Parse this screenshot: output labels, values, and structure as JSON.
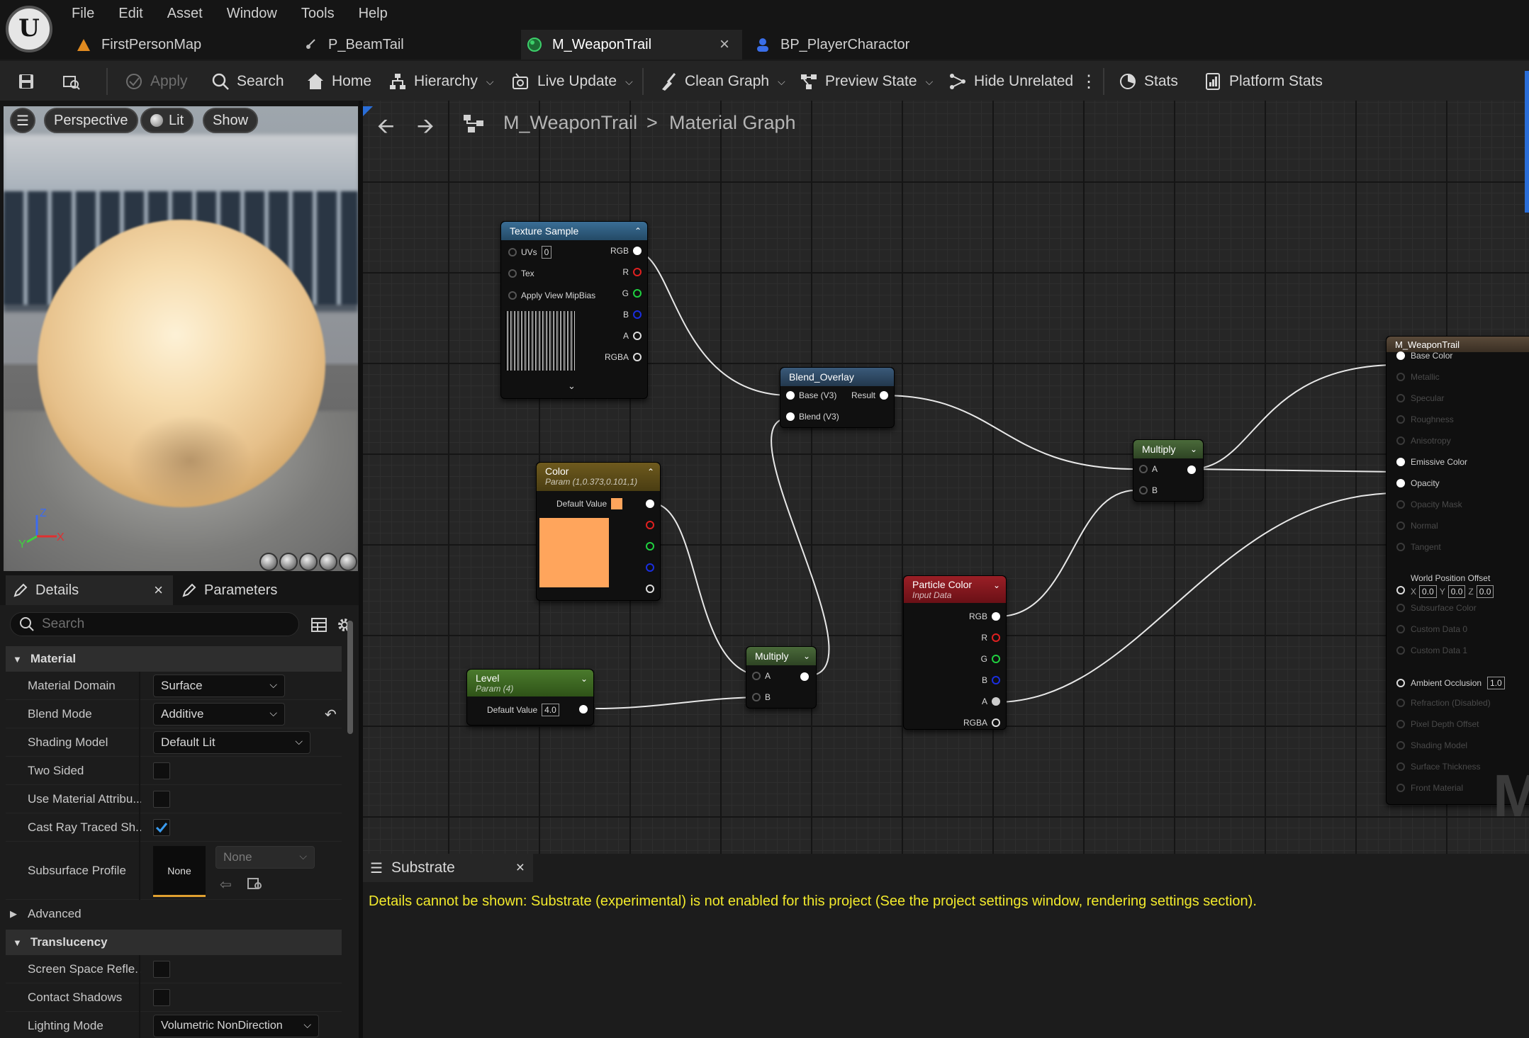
{
  "app": {
    "logo": "unreal-engine-logo"
  },
  "menu": [
    "File",
    "Edit",
    "Asset",
    "Window",
    "Tools",
    "Help"
  ],
  "tabs": [
    {
      "label": "FirstPersonMap",
      "icon": "level-icon"
    },
    {
      "label": "P_BeamTail",
      "icon": "particle-icon"
    },
    {
      "label": "M_WeaponTrail",
      "icon": "material-icon",
      "close": "×",
      "active": true
    },
    {
      "label": "BP_PlayerCharactor",
      "icon": "blueprint-icon"
    }
  ],
  "toolbar": {
    "apply": "Apply",
    "search": "Search",
    "home": "Home",
    "hierarchy": "Hierarchy",
    "live_update": "Live Update",
    "clean_graph": "Clean Graph",
    "preview_state": "Preview State",
    "hide_unrelated": "Hide Unrelated",
    "stats": "Stats",
    "platform_stats": "Platform Stats"
  },
  "viewport": {
    "perspective": "Perspective",
    "lit": "Lit",
    "show": "Show",
    "axis_z": "Z",
    "axis_y": "Y",
    "axis_x": "X"
  },
  "details": {
    "tab_details": "Details",
    "tab_parameters": "Parameters",
    "close": "×",
    "search_placeholder": "Search",
    "material_category": "Material",
    "rows": {
      "material_domain": {
        "label": "Material Domain",
        "value": "Surface"
      },
      "blend_mode": {
        "label": "Blend Mode",
        "value": "Additive"
      },
      "shading_model": {
        "label": "Shading Model",
        "value": "Default Lit"
      },
      "two_sided": {
        "label": "Two Sided",
        "checked": false
      },
      "use_material_attributes": {
        "label": "Use Material Attribu...",
        "checked": false
      },
      "cast_ray_traced": {
        "label": "Cast Ray Traced Sh...",
        "checked": true
      },
      "subsurface_profile": {
        "label": "Subsurface Profile",
        "thumb": "None",
        "value": "None"
      }
    },
    "advanced": "Advanced",
    "translucency_category": "Translucency",
    "t_rows": {
      "screen_space": {
        "label": "Screen Space Refle...",
        "checked": false
      },
      "contact_shadows": {
        "label": "Contact Shadows",
        "checked": false
      },
      "lighting_mode": {
        "label": "Lighting Mode",
        "value": "Volumetric NonDirection"
      }
    }
  },
  "graph": {
    "breadcrumb_asset": "M_WeaponTrail",
    "breadcrumb_sep": ">",
    "breadcrumb_graph": "Material Graph",
    "texture_sample": {
      "title": "Texture Sample",
      "uvs": "UVs",
      "uvs_val": "0",
      "tex": "Tex",
      "mip": "Apply View MipBias",
      "out": [
        "RGB",
        "R",
        "G",
        "B",
        "A",
        "RGBA"
      ]
    },
    "blend_overlay": {
      "title": "Blend_Overlay",
      "base": "Base (V3)",
      "blend": "Blend (V3)",
      "result": "Result"
    },
    "color": {
      "title": "Color",
      "subtitle": "Param (1,0.373,0.101,1)",
      "default_label": "Default Value",
      "swatch": "#ffa55c"
    },
    "level": {
      "title": "Level",
      "subtitle": "Param (4)",
      "default_label": "Default Value",
      "default_val": "4.0"
    },
    "multiply1": {
      "title": "Multiply",
      "a": "A",
      "b": "B"
    },
    "multiply2": {
      "title": "Multiply",
      "a": "A",
      "b": "B"
    },
    "particle_color": {
      "title": "Particle Color",
      "subtitle": "Input Data",
      "out": [
        "RGB",
        "R",
        "G",
        "B",
        "A",
        "RGBA"
      ]
    },
    "material_output": {
      "title": "M_WeaponTrail",
      "pins": [
        {
          "label": "Base Color",
          "active": true
        },
        {
          "label": "Metallic",
          "active": false
        },
        {
          "label": "Specular",
          "active": false
        },
        {
          "label": "Roughness",
          "active": false
        },
        {
          "label": "Anisotropy",
          "active": false
        },
        {
          "label": "Emissive Color",
          "active": true
        },
        {
          "label": "Opacity",
          "active": true
        },
        {
          "label": "Opacity Mask",
          "active": false
        },
        {
          "label": "Normal",
          "active": false
        },
        {
          "label": "Tangent",
          "active": false
        }
      ],
      "wpo": {
        "label": "World Position Offset",
        "x": "X",
        "xv": "0.0",
        "y": "Y",
        "yv": "0.0",
        "z": "Z",
        "zv": "0.0"
      },
      "pins2": [
        {
          "label": "Subsurface Color",
          "active": false
        },
        {
          "label": "Custom Data 0",
          "active": false
        },
        {
          "label": "Custom Data 1",
          "active": false
        }
      ],
      "ao": {
        "label": "Ambient Occlusion",
        "value": "1.0"
      },
      "pins3": [
        {
          "label": "Refraction (Disabled)",
          "active": false
        },
        {
          "label": "Pixel Depth Offset",
          "active": false
        },
        {
          "label": "Shading Model",
          "active": false
        },
        {
          "label": "Surface Thickness",
          "active": false
        },
        {
          "label": "Front Material",
          "active": false
        }
      ],
      "watermark": "M"
    }
  },
  "substrate": {
    "tab": "Substrate",
    "close": "×",
    "message": "Details cannot be shown: Substrate (experimental) is not enabled for this project (See the project settings window, rendering settings section)."
  }
}
